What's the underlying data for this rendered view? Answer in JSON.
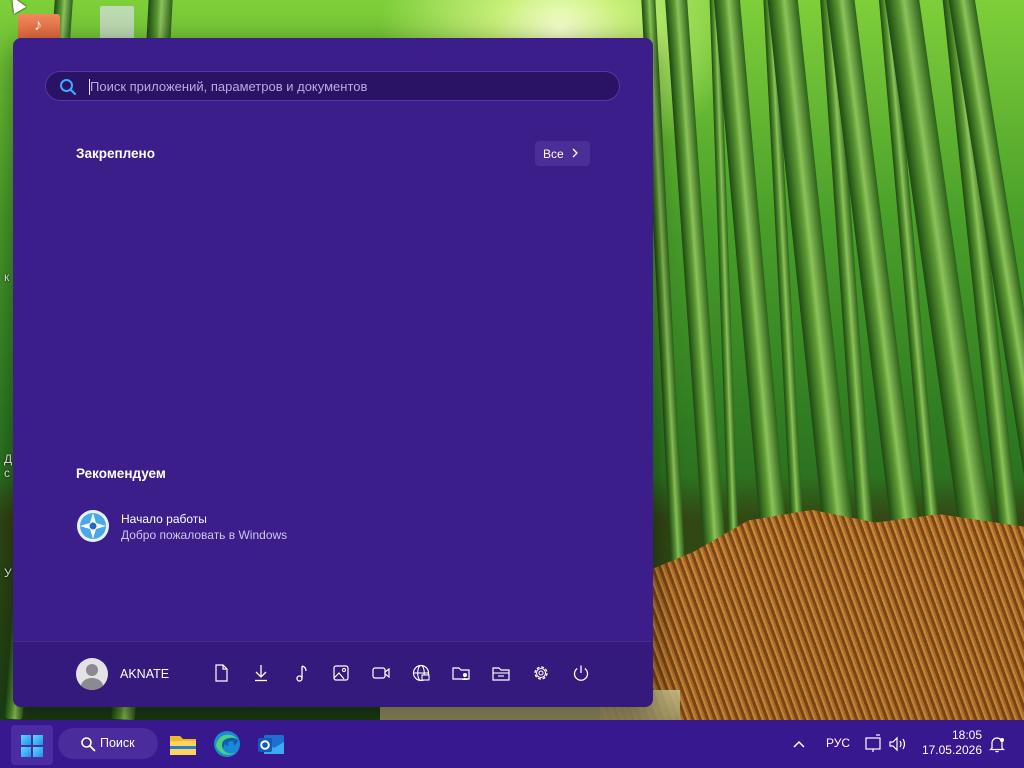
{
  "desktop": {
    "labels": [
      "к",
      "Д",
      "с",
      "У"
    ]
  },
  "start_menu": {
    "search": {
      "placeholder": "Поиск приложений, параметров и документов",
      "value": ""
    },
    "pinned": {
      "title": "Закреплено",
      "all_button_label": "Все"
    },
    "recommended": {
      "title": "Рекомендуем",
      "items": [
        {
          "name": "Начало работы",
          "description": "Добро пожаловать в Windows",
          "icon": "get-started-icon"
        }
      ]
    },
    "footer": {
      "user_name": "AKNATE",
      "folder_buttons": [
        {
          "name": "documents",
          "icon": "document-icon"
        },
        {
          "name": "downloads",
          "icon": "download-icon"
        },
        {
          "name": "music",
          "icon": "music-icon"
        },
        {
          "name": "pictures",
          "icon": "picture-icon"
        },
        {
          "name": "videos",
          "icon": "video-icon"
        },
        {
          "name": "network",
          "icon": "network-icon"
        },
        {
          "name": "personal-folder",
          "icon": "personal-folder-icon"
        },
        {
          "name": "file-explorer",
          "icon": "file-explorer-icon"
        },
        {
          "name": "settings",
          "icon": "gear-icon"
        },
        {
          "name": "power",
          "icon": "power-icon"
        }
      ]
    }
  },
  "taskbar": {
    "search_label": "Поиск",
    "apps": [
      {
        "name": "file-explorer",
        "icon": "folder-icon"
      },
      {
        "name": "edge",
        "icon": "edge-icon"
      },
      {
        "name": "outlook",
        "icon": "outlook-icon"
      }
    ],
    "language": "РУС",
    "time": "18:05",
    "date": "17.05.2026"
  },
  "colors": {
    "start_menu_bg": "#3b1e8a",
    "taskbar_bg": "#38188e",
    "accent": "#5fd7ff"
  }
}
